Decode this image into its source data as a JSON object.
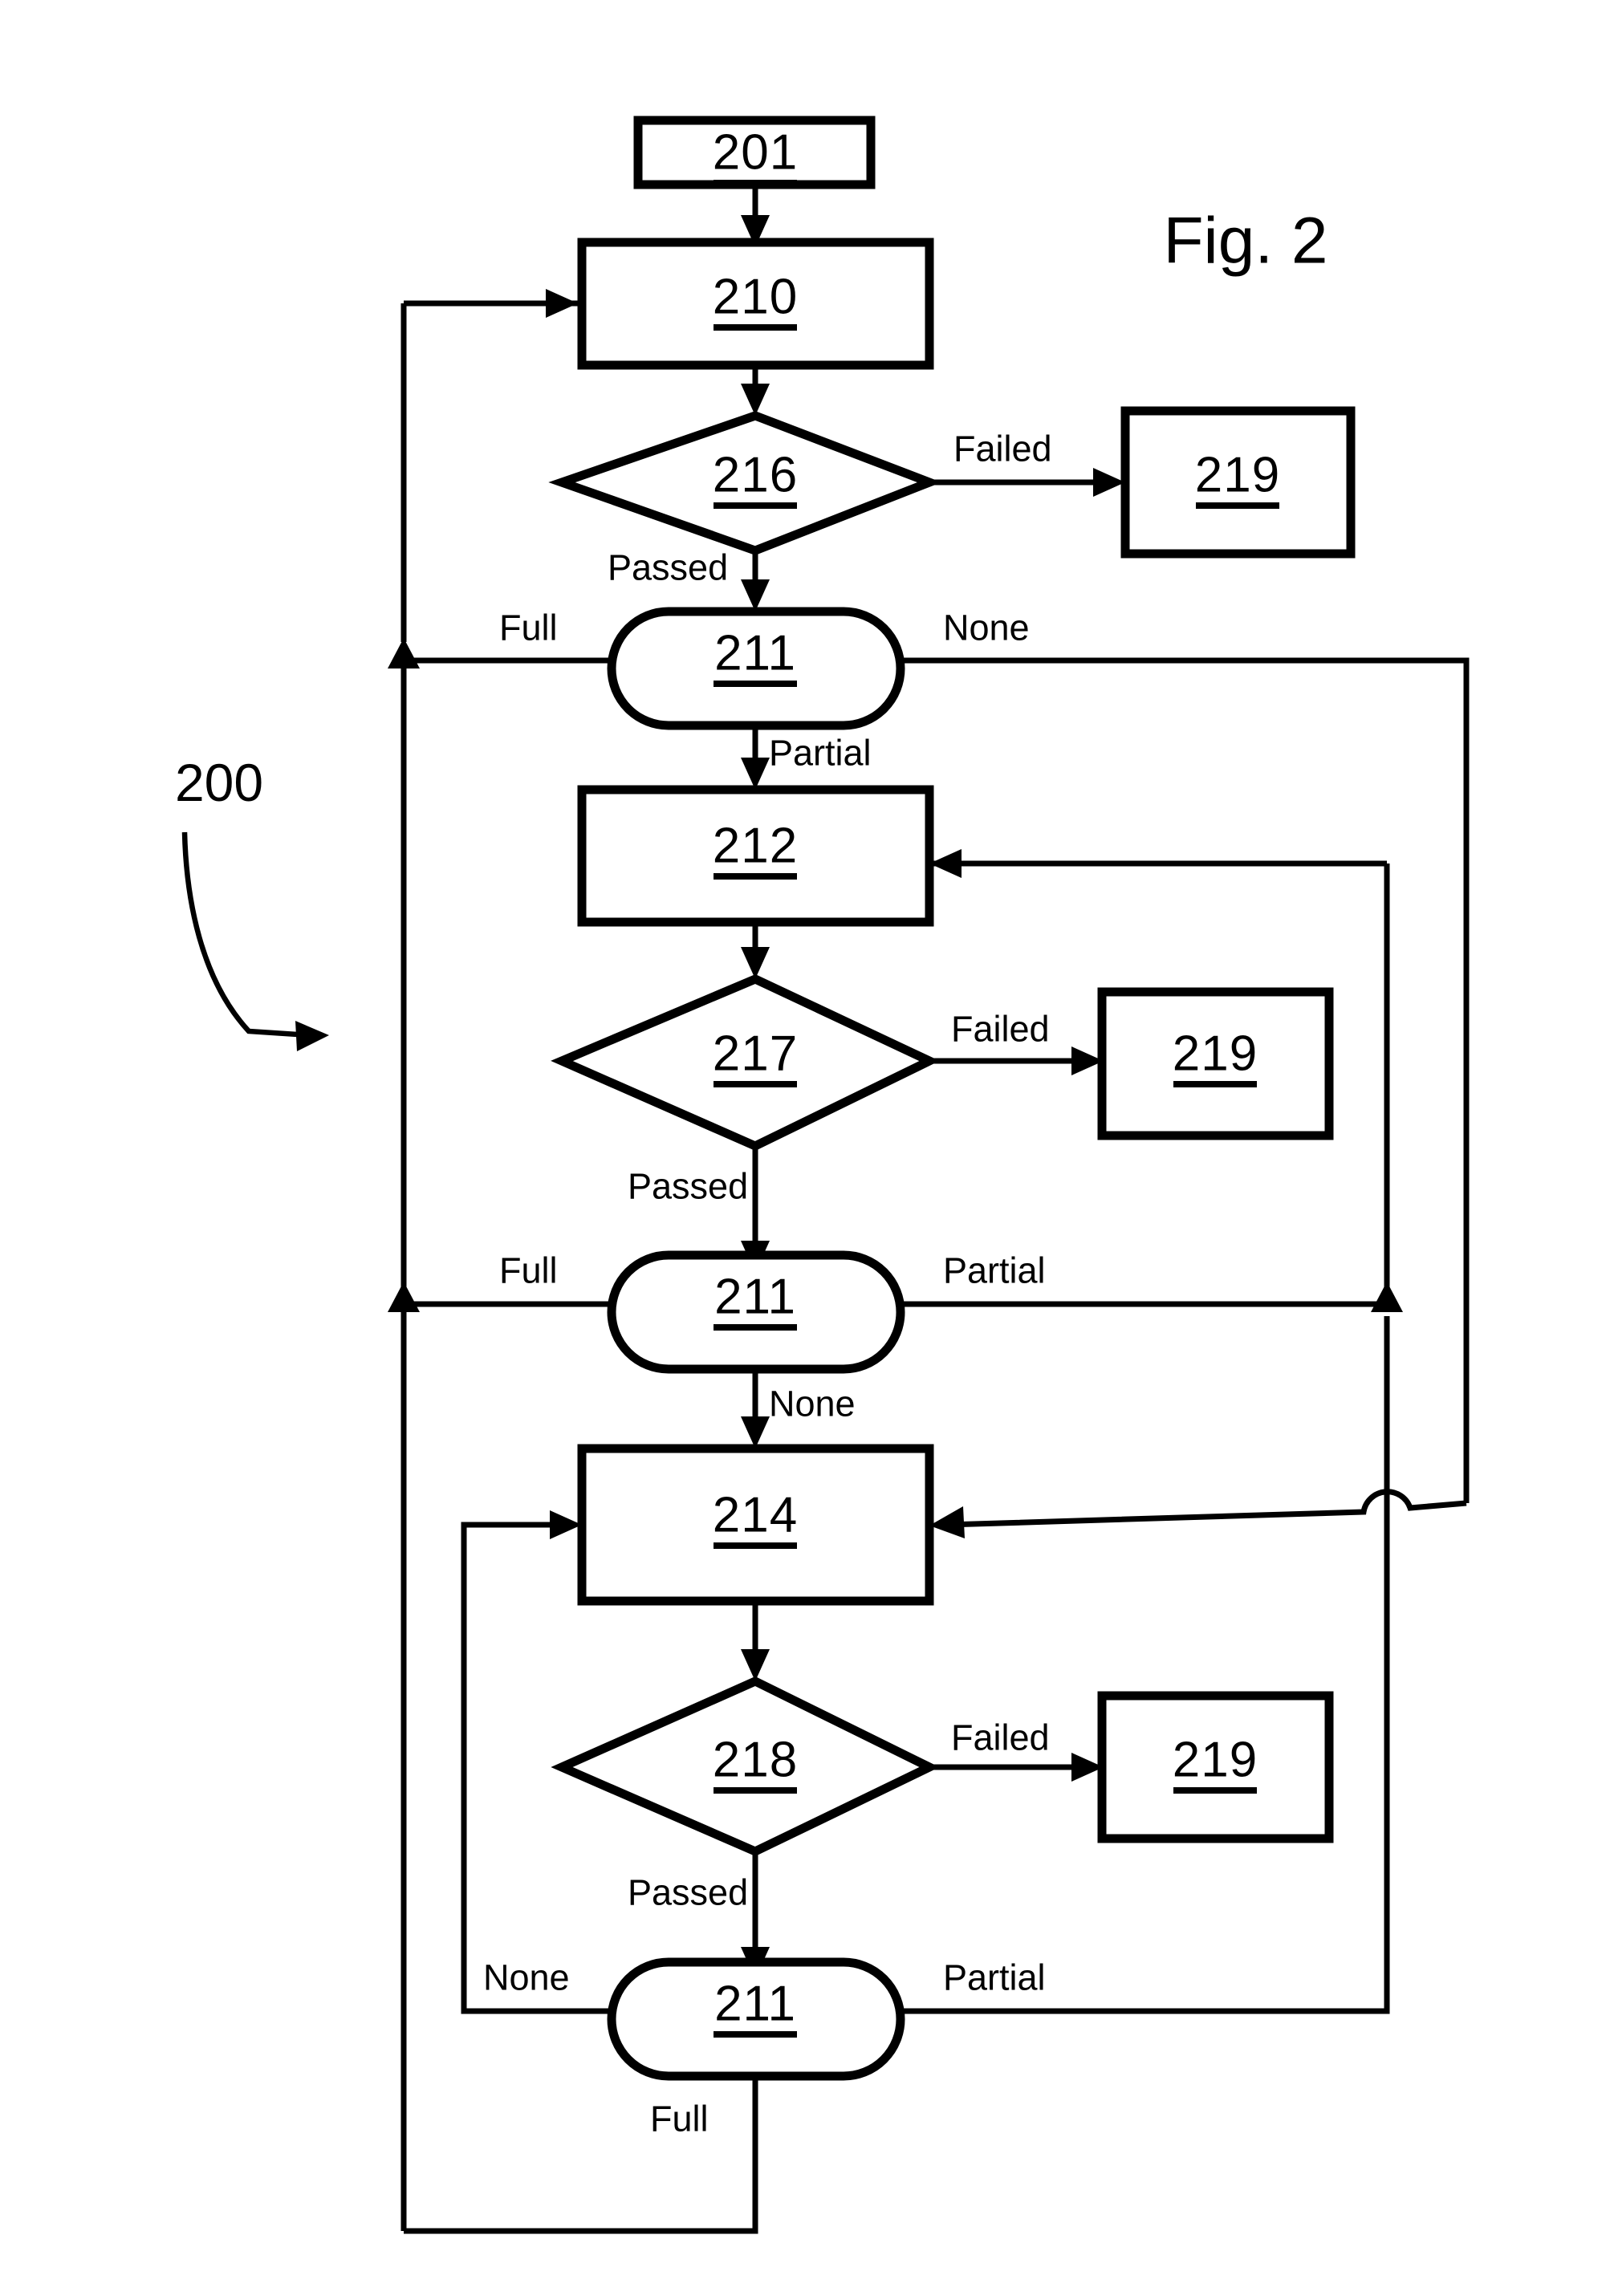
{
  "figure": {
    "title": "Fig. 2",
    "reference_numeral": "200"
  },
  "nodes": [
    {
      "id": "n201",
      "label": "201",
      "shape": "rectangle",
      "underlined": true
    },
    {
      "id": "n210",
      "label": "210",
      "shape": "rectangle",
      "underlined": true
    },
    {
      "id": "n216",
      "label": "216",
      "shape": "diamond",
      "underlined": true
    },
    {
      "id": "n219a",
      "label": "219",
      "shape": "rectangle",
      "underlined": true
    },
    {
      "id": "n211a",
      "label": "211",
      "shape": "stadium",
      "underlined": true
    },
    {
      "id": "n212",
      "label": "212",
      "shape": "rectangle",
      "underlined": true
    },
    {
      "id": "n217",
      "label": "217",
      "shape": "diamond",
      "underlined": true
    },
    {
      "id": "n219b",
      "label": "219",
      "shape": "rectangle",
      "underlined": true
    },
    {
      "id": "n211b",
      "label": "211",
      "shape": "stadium",
      "underlined": true
    },
    {
      "id": "n214",
      "label": "214",
      "shape": "rectangle",
      "underlined": true
    },
    {
      "id": "n218",
      "label": "218",
      "shape": "diamond",
      "underlined": true
    },
    {
      "id": "n219c",
      "label": "219",
      "shape": "rectangle",
      "underlined": true
    },
    {
      "id": "n211c",
      "label": "211",
      "shape": "stadium",
      "underlined": true
    }
  ],
  "edge_labels": {
    "e216_failed": "Failed",
    "e216_passed": "Passed",
    "e211a_full": "Full",
    "e211a_none": "None",
    "e211a_partial": "Partial",
    "e217_failed": "Failed",
    "e217_passed": "Passed",
    "e211b_full": "Full",
    "e211b_partial": "Partial",
    "e211b_none": "None",
    "e218_failed": "Failed",
    "e218_passed": "Passed",
    "e211c_none": "None",
    "e211c_partial": "Partial",
    "e211c_full": "Full"
  },
  "colors": {
    "stroke": "#000000",
    "fill": "#ffffff",
    "background": "#ffffff"
  }
}
